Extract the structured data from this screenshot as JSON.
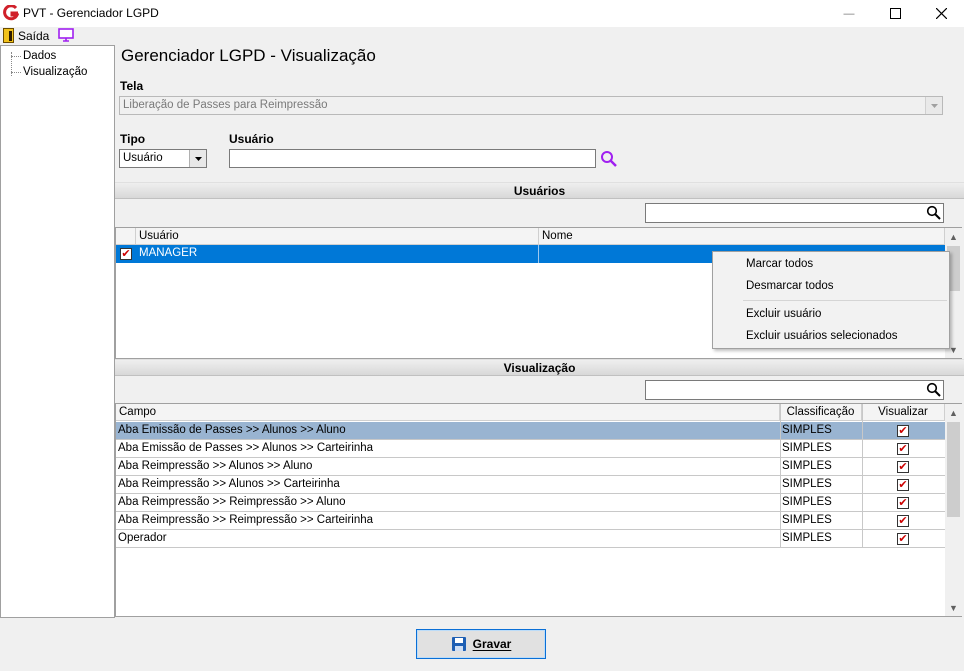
{
  "window": {
    "title": "PVT - Gerenciador LGPD",
    "minimize_glyph": "—",
    "maximize_glyph": "☐",
    "close_glyph": "✕"
  },
  "toolbar": {
    "exit_label": "Saída",
    "exit_icon": "exit-door-icon",
    "monitor_icon": "monitor-icon"
  },
  "tree": {
    "items": [
      "Dados",
      "Visualização"
    ]
  },
  "main": {
    "title": "Gerenciador LGPD - Visualização",
    "tela_label": "Tela",
    "tela_value": "Liberação de Passes para Reimpressão",
    "tipo_label": "Tipo",
    "tipo_value": "Usuário",
    "usuario_label": "Usuário",
    "usuario_value": ""
  },
  "usuarios": {
    "header": "Usuários",
    "filter_value": "",
    "columns": [
      "Usuário",
      "Nome"
    ],
    "rows": [
      {
        "checked": true,
        "usuario": "MANAGER",
        "nome": ""
      }
    ]
  },
  "context_menu": {
    "items": [
      "Marcar todos",
      "Desmarcar todos",
      "Excluir usuário",
      "Excluir usuários selecionados"
    ]
  },
  "visualizacao": {
    "header": "Visualização",
    "filter_value": "",
    "columns": [
      "Campo",
      "Classificação",
      "Visualizar"
    ],
    "rows": [
      {
        "campo": "Aba Emissão de Passes >> Alunos >> Aluno",
        "classificacao": "SIMPLES",
        "visualizar": true
      },
      {
        "campo": "Aba Emissão de Passes >> Alunos >> Carteirinha",
        "classificacao": "SIMPLES",
        "visualizar": true
      },
      {
        "campo": "Aba Reimpressão >> Alunos >> Aluno",
        "classificacao": "SIMPLES",
        "visualizar": true
      },
      {
        "campo": "Aba Reimpressão >> Alunos >> Carteirinha",
        "classificacao": "SIMPLES",
        "visualizar": true
      },
      {
        "campo": "Aba Reimpressão >> Reimpressão >> Aluno",
        "classificacao": "SIMPLES",
        "visualizar": true
      },
      {
        "campo": "Aba Reimpressão >> Reimpressão >> Carteirinha",
        "classificacao": "SIMPLES",
        "visualizar": true
      },
      {
        "campo": "Operador",
        "classificacao": "SIMPLES",
        "visualizar": true
      }
    ]
  },
  "footer": {
    "save_label": "Gravar"
  },
  "colors": {
    "selection": "#0078d7",
    "row_highlight": "#99b4d1",
    "check_mark": "#cc0000",
    "accent_icon": "#a020f0"
  }
}
